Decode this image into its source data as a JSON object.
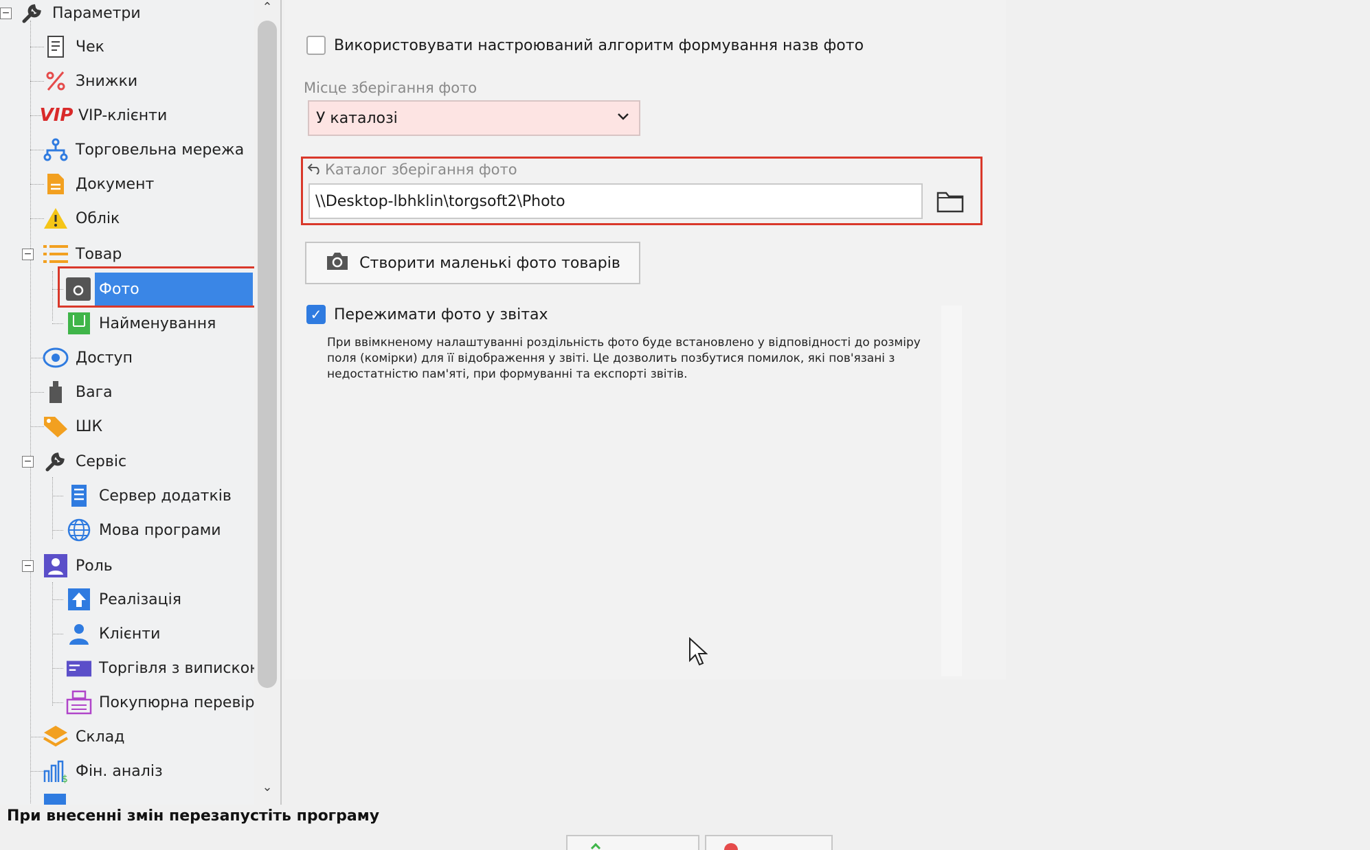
{
  "tree": {
    "root": "Параметри",
    "items": [
      {
        "label": "Чек",
        "icon": "receipt-icon"
      },
      {
        "label": "Знижки",
        "icon": "percent-icon"
      },
      {
        "label": "VIP-клієнти",
        "icon": "vip-icon",
        "icon_text": "VIP"
      },
      {
        "label": "Торговельна мережа",
        "icon": "network-icon"
      },
      {
        "label": "Документ",
        "icon": "document-icon"
      },
      {
        "label": "Облік",
        "icon": "warning-icon"
      },
      {
        "label": "Товар",
        "icon": "list-icon"
      },
      {
        "label": "Фото",
        "icon": "camera-icon"
      },
      {
        "label": "Найменування",
        "icon": "naming-icon"
      },
      {
        "label": "Доступ",
        "icon": "eye-icon"
      },
      {
        "label": "Вага",
        "icon": "weight-icon"
      },
      {
        "label": "ШК",
        "icon": "tag-icon"
      },
      {
        "label": "Сервіс",
        "icon": "wrench-icon"
      },
      {
        "label": "Сервер додатків",
        "icon": "server-icon"
      },
      {
        "label": "Мова програми",
        "icon": "globe-icon"
      },
      {
        "label": "Роль",
        "icon": "user-card-icon"
      },
      {
        "label": "Реалізація",
        "icon": "upload-icon"
      },
      {
        "label": "Клієнти",
        "icon": "person-icon"
      },
      {
        "label": "Торгівля з випискою",
        "icon": "invoice-icon"
      },
      {
        "label": "Покупюрна перевірк:",
        "icon": "cash-register-icon"
      },
      {
        "label": "Склад",
        "icon": "layers-icon"
      },
      {
        "label": "Фін. аналіз",
        "icon": "finance-chart-icon"
      }
    ]
  },
  "content": {
    "custom_algo_label": "Використовувати настроюваний алгоритм формування назв фото",
    "storage_place_label": "Місце зберігання фото",
    "storage_place_value": "У каталозі",
    "catalog_label": "Каталог зберігання фото",
    "catalog_path": "\\\\Desktop-lbhklin\\torgsoft2\\Photo",
    "create_thumbs_button": "Створити маленькі фото товарів",
    "compress_label": "Пережимати фото у звітах",
    "compress_checked": true,
    "custom_algo_checked": false,
    "note": "При ввімкненому налаштуванні роздільність фото буде встановлено у відповідності до розміру поля (комірки) для її відображення у звіті. Це дозволить позбутися помилок, які пов'язані з недостатністю пам'яті, при формуванні та експорті звітів."
  },
  "footer": {
    "restart_note": "При внесенні змін перезапустіть програму"
  },
  "colors": {
    "selection": "#3a86e6",
    "highlight_border": "#d9382a",
    "select_bg": "#fde4e3"
  }
}
